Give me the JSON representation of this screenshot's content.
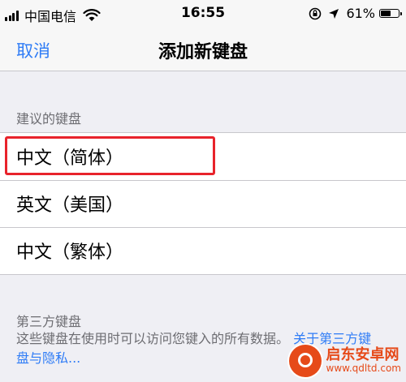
{
  "status_bar": {
    "carrier": "中国电信",
    "time": "16:55",
    "battery_percent": "61%",
    "battery_level": 0.61
  },
  "nav": {
    "cancel_label": "取消",
    "title": "添加新键盘"
  },
  "suggested": {
    "header": "建议的键盘",
    "items": [
      {
        "label": "中文（简体）"
      },
      {
        "label": "英文（美国）"
      },
      {
        "label": "中文（繁体）"
      }
    ]
  },
  "third_party": {
    "header": "第三方键盘",
    "description": "这些键盘在使用时可以访问您键入的所有数据。",
    "link_label": "关于第三方键盘与隐私..."
  },
  "watermark": {
    "name": "启东安卓网",
    "url": "www.qdltd.com"
  },
  "colors": {
    "accent": "#2f7cf6",
    "highlight": "#e8232b",
    "background": "#efeff4"
  }
}
